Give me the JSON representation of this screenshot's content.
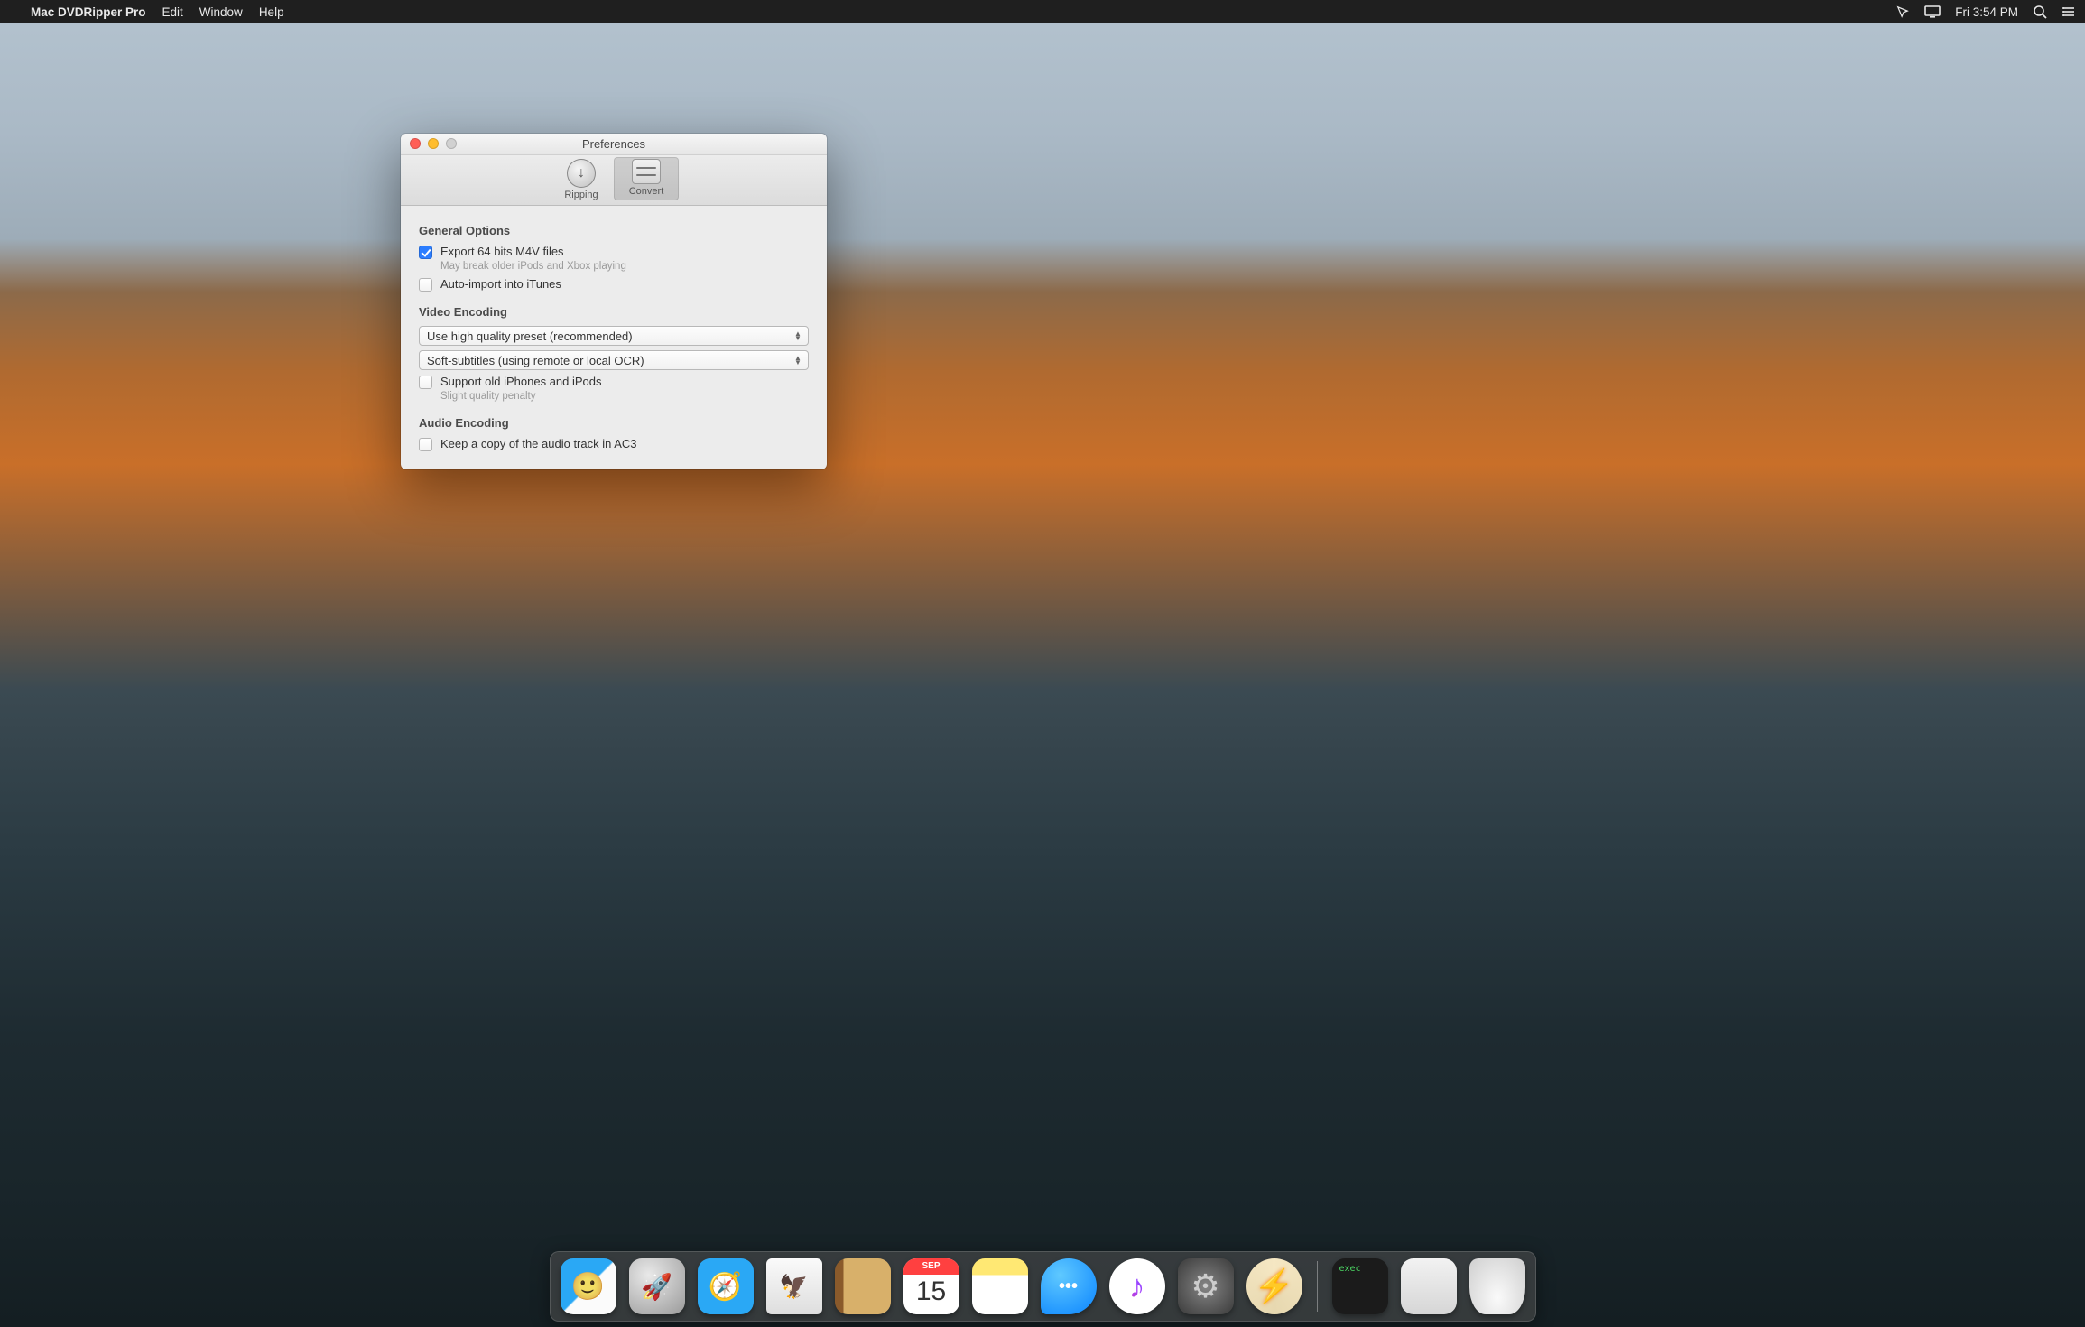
{
  "menubar": {
    "app_name": "Mac DVDRipper Pro",
    "items": [
      "Edit",
      "Window",
      "Help"
    ],
    "clock": "Fri 3:54 PM"
  },
  "window": {
    "title": "Preferences",
    "tabs": {
      "ripping": "Ripping",
      "convert": "Convert",
      "selected": "convert"
    },
    "sections": {
      "general": {
        "title": "General Options",
        "export64": {
          "label": "Export 64 bits M4V files",
          "sub": "May break older iPods and Xbox playing",
          "checked": true
        },
        "autoimport": {
          "label": "Auto-import into iTunes",
          "checked": false
        }
      },
      "video": {
        "title": "Video Encoding",
        "preset": "Use high quality preset (recommended)",
        "subtitles": "Soft-subtitles (using remote or local OCR)",
        "oldiphones": {
          "label": "Support old iPhones and iPods",
          "sub": "Slight quality penalty",
          "checked": false
        }
      },
      "audio": {
        "title": "Audio Encoding",
        "ac3": {
          "label": "Keep a copy of the audio track in AC3",
          "checked": false
        }
      }
    }
  },
  "dock": {
    "cal_month": "SEP",
    "cal_day": "15",
    "term_label": "exec"
  }
}
